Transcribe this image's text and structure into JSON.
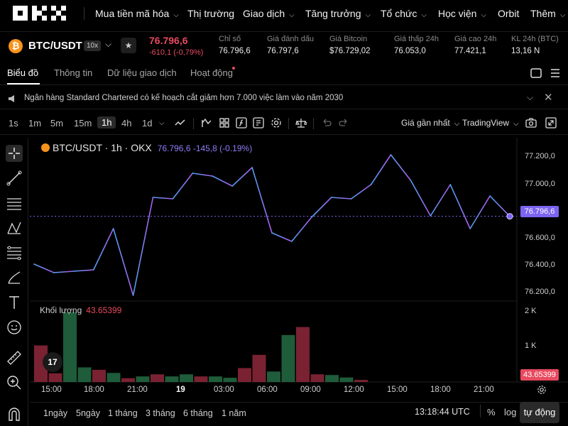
{
  "nav": {
    "logo_text": "OKX",
    "items": [
      {
        "label": "Mua tiền mã hóa",
        "chevron": true
      },
      {
        "label": "Thị trường",
        "chevron": false
      },
      {
        "label": "Giao dịch",
        "chevron": true
      },
      {
        "label": "Tăng trưởng",
        "chevron": true
      },
      {
        "label": "Tổ chức",
        "chevron": true
      },
      {
        "label": "Học viện",
        "chevron": true
      },
      {
        "label": "Orbit",
        "chevron": false
      },
      {
        "label": "Thêm",
        "chevron": true
      }
    ]
  },
  "ticker": {
    "coin_icon": "₿",
    "pair": "BTC/USDT",
    "leverage": "10x",
    "last_price": "76.796,6",
    "change": "-610,1 (-0,79%)",
    "stats": [
      {
        "label": "Chỉ số",
        "value": "76.796,6"
      },
      {
        "label": "Giá đánh dấu",
        "value": "76.797,6"
      },
      {
        "label": "Giá Bitcoin",
        "value": "$76.729,02"
      },
      {
        "label": "Giá thấp 24h",
        "value": "76.053,0"
      },
      {
        "label": "Giá cao 24h",
        "value": "77.421,1"
      },
      {
        "label": "KL 24h (BTC)",
        "value": "13,16 N"
      }
    ]
  },
  "tabs": [
    "Biểu đồ",
    "Thông tin",
    "Dữ liệu giao dịch",
    "Hoạt động"
  ],
  "news": {
    "text": "Ngân hàng Standard Chartered có kế hoạch cắt giảm hơn 7.000 việc làm vào năm 2030"
  },
  "toolbar": {
    "timeframes": [
      "1s",
      "1m",
      "5m",
      "15m",
      "1h",
      "4h",
      "1d"
    ],
    "active_timeframe": "1h",
    "price_type": "Giá gần nhất",
    "chart_engine": "TradingView"
  },
  "chart": {
    "title": "BTC/USDT · 1h · OKX",
    "ohlc_text": "76.796,6  -145,8 (-0.19%)",
    "volume_label": "Khối lượng",
    "volume_value": "43.65399",
    "price_ticks": [
      "77.200,0",
      "77.000,0",
      "76.600,0",
      "76.400,0",
      "76.200,0"
    ],
    "current_price_tag": "76.796,6",
    "volume_ticks": [
      "2 K",
      "1 K"
    ],
    "time_ticks": [
      "15:00",
      "18:00",
      "21:00",
      "19",
      "03:00",
      "06:00",
      "09:00",
      "12:00",
      "15:00",
      "18:00",
      "21:00"
    ],
    "bold_tick": "19",
    "tv_logo": "17",
    "line_color_start": "#4aa3f0",
    "line_color_end": "#b05cf0",
    "up_color": "#1e5c3a",
    "down_color": "#7a2232"
  },
  "chart_data": {
    "type": "line",
    "title": "BTC/USDT · 1h · OKX",
    "series": [
      {
        "values": [
          76460,
          76400,
          76410,
          76420,
          76710,
          76240,
          76930,
          76920,
          77100,
          77080,
          77010,
          77140,
          76680,
          76620,
          76790,
          76930,
          76920,
          77020,
          77230,
          77050,
          76800,
          77020,
          76710,
          76940,
          76796.6
        ]
      }
    ],
    "ylim": [
      76200,
      77300
    ],
    "volume": [
      {
        "value": 1050,
        "dir": "down"
      },
      {
        "value": 250,
        "dir": "down"
      },
      {
        "value": 2000,
        "dir": "up"
      },
      {
        "value": 420,
        "dir": "up"
      },
      {
        "value": 350,
        "dir": "down"
      },
      {
        "value": 260,
        "dir": "up"
      },
      {
        "value": 110,
        "dir": "down"
      },
      {
        "value": 160,
        "dir": "up"
      },
      {
        "value": 220,
        "dir": "down"
      },
      {
        "value": 160,
        "dir": "up"
      },
      {
        "value": 220,
        "dir": "up"
      },
      {
        "value": 160,
        "dir": "down"
      },
      {
        "value": 160,
        "dir": "up"
      },
      {
        "value": 120,
        "dir": "up"
      },
      {
        "value": 400,
        "dir": "down"
      },
      {
        "value": 780,
        "dir": "down"
      },
      {
        "value": 300,
        "dir": "up"
      },
      {
        "value": 1350,
        "dir": "up"
      },
      {
        "value": 1580,
        "dir": "down"
      },
      {
        "value": 220,
        "dir": "down"
      },
      {
        "value": 200,
        "dir": "up"
      },
      {
        "value": 130,
        "dir": "up"
      },
      {
        "value": 60,
        "dir": "down"
      }
    ]
  },
  "bottombar": {
    "ranges": [
      "1ngày",
      "5ngày",
      "1 tháng",
      "3 tháng",
      "6 tháng",
      "1 năm"
    ],
    "clock": "13:18:44 UTC",
    "percent": "%",
    "log": "log",
    "auto": "tự động"
  }
}
